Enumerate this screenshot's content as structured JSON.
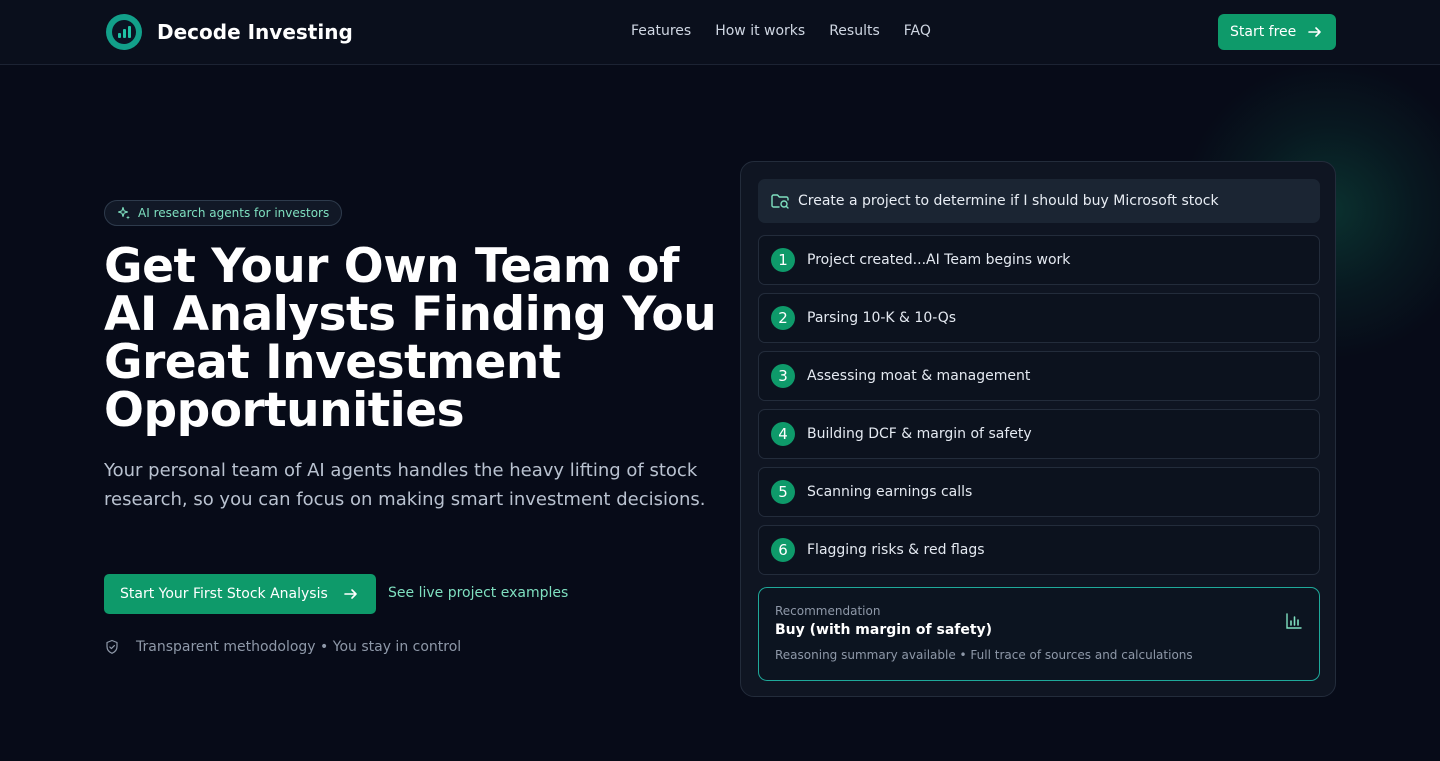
{
  "brand": {
    "name": "Decode Investing"
  },
  "nav": {
    "links": [
      "Features",
      "How it works",
      "Results",
      "FAQ"
    ],
    "cta_label": "Start free"
  },
  "hero": {
    "pill_label": "AI research agents for investors",
    "headline": "Get Your Own Team of AI Analysts Finding You Great Investment Opportunities",
    "subheadline": "Your personal team of AI agents handles the heavy lifting of stock research, so you can focus on making smart investment decisions.",
    "primary_cta": "Start Your First Stock Analysis",
    "secondary_cta": "See live project examples",
    "trust_text": "Transparent methodology • You stay in control"
  },
  "panel": {
    "prompt": "Create a project to determine if I should buy Microsoft stock",
    "steps": [
      {
        "num": "1",
        "label": "Project created...AI Team begins work"
      },
      {
        "num": "2",
        "label": "Parsing 10-K & 10-Qs"
      },
      {
        "num": "3",
        "label": "Assessing moat & management"
      },
      {
        "num": "4",
        "label": "Building DCF & margin of safety"
      },
      {
        "num": "5",
        "label": "Scanning earnings calls"
      },
      {
        "num": "6",
        "label": "Flagging risks & red flags"
      }
    ],
    "recommendation": {
      "label": "Recommendation",
      "value": "Buy (with margin of safety)",
      "note": "Reasoning summary available • Full trace of sources and calculations"
    }
  },
  "colors": {
    "background": "#070b18",
    "accent": "#0e9a6a",
    "accent_text": "#7fe0c0",
    "teal_border": "#1fa99a"
  },
  "icons": [
    "logo-chart-icon",
    "arrow-right-icon",
    "sparkle-icon",
    "shield-check-icon",
    "folder-search-icon",
    "bar-chart-icon"
  ]
}
